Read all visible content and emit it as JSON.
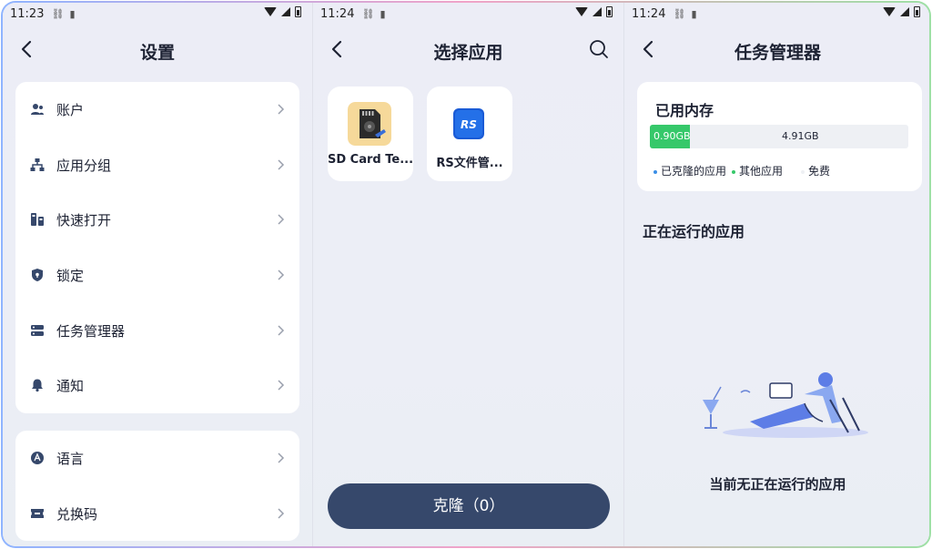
{
  "status_bars": [
    {
      "time": "11:23"
    },
    {
      "time": "11:24"
    },
    {
      "time": "11:24"
    }
  ],
  "settings": {
    "title": "设置",
    "group1": [
      {
        "label": "账户",
        "icon": "user-icon"
      },
      {
        "label": "应用分组",
        "icon": "hierarchy-icon"
      },
      {
        "label": "快速打开",
        "icon": "quick-open-icon"
      },
      {
        "label": "锁定",
        "icon": "lock-shield-icon"
      },
      {
        "label": "任务管理器",
        "icon": "task-manager-icon"
      },
      {
        "label": "通知",
        "icon": "bell-icon"
      }
    ],
    "group2": [
      {
        "label": "语言",
        "icon": "language-icon"
      },
      {
        "label": "兑换码",
        "icon": "ticket-icon"
      }
    ]
  },
  "select_app": {
    "title": "选择应用",
    "apps": [
      {
        "name": "SD Card Te...",
        "icon": "sd-card-app-icon"
      },
      {
        "name": "RS文件管...",
        "icon": "rs-file-manager-icon",
        "icon_text": "RS"
      }
    ],
    "clone_button": "克隆（0）"
  },
  "task_manager": {
    "title": "任务管理器",
    "memory": {
      "title": "已用内存",
      "used_label": "0.90GB",
      "free_label": "4.91GB",
      "used_fraction": 0.155,
      "legend": [
        {
          "label": "已克隆的应用",
          "color": "#3a8ee6"
        },
        {
          "label": "其他应用",
          "color": "#36c86a"
        },
        {
          "label": "免费",
          "color": "#eef0f4"
        }
      ]
    },
    "running_title": "正在运行的应用",
    "empty_text": "当前无正在运行的应用"
  },
  "colors": {
    "accent_dark": "#36486b",
    "memory_green": "#36c86a",
    "text": "#1d2233"
  }
}
